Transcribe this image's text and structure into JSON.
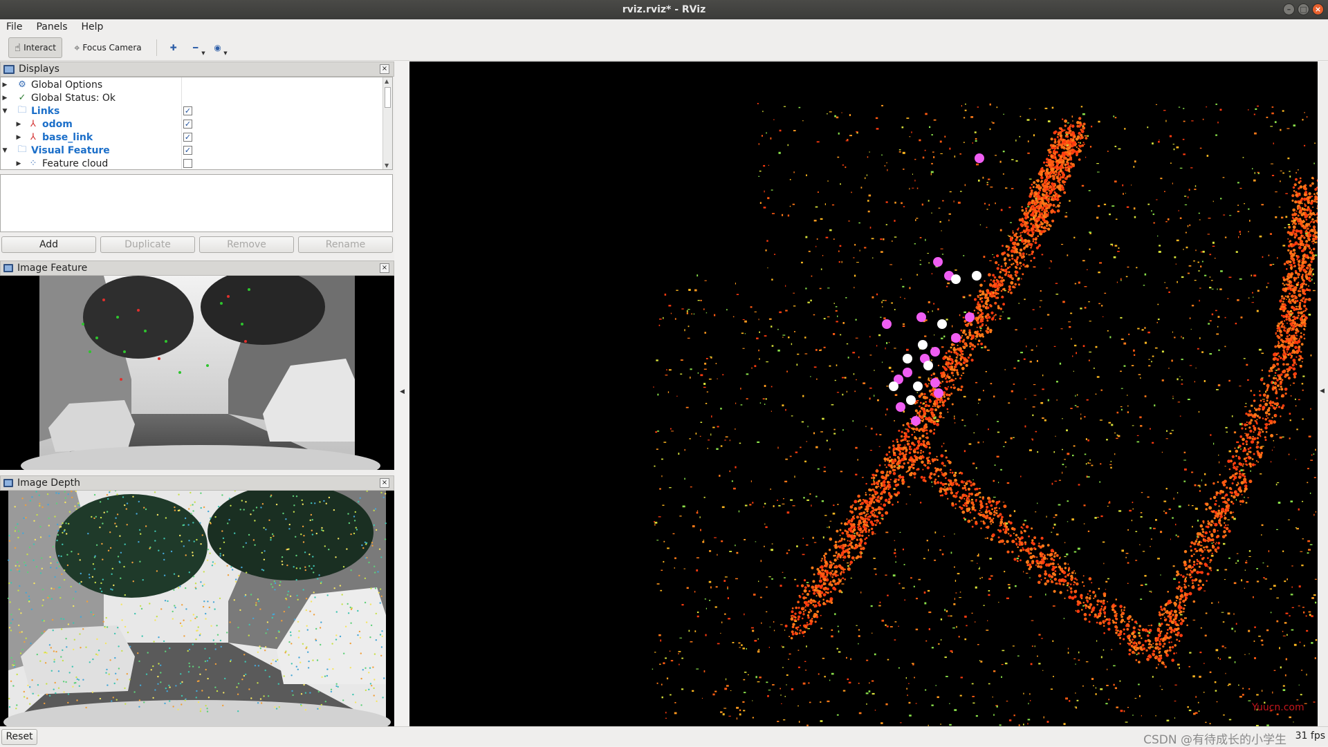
{
  "window": {
    "title": "rviz.rviz* - RViz"
  },
  "menu": [
    "File",
    "Panels",
    "Help"
  ],
  "toolbar": {
    "interact": "Interact",
    "focus_camera": "Focus Camera"
  },
  "displays": {
    "title": "Displays",
    "rows": [
      {
        "label": "Global Options",
        "icon": "gear-icon",
        "checked": null
      },
      {
        "label": "Global Status: Ok",
        "icon": "check-icon",
        "checked": null
      },
      {
        "label": "Links",
        "icon": "folder-icon",
        "checked": true
      },
      {
        "label": "odom",
        "icon": "axes-icon",
        "checked": true
      },
      {
        "label": "base_link",
        "icon": "axes-icon",
        "checked": true
      },
      {
        "label": "Visual Feature",
        "icon": "folder-icon",
        "checked": true
      },
      {
        "label": "Feature cloud",
        "icon": "pointcloud-icon",
        "checked": false
      }
    ],
    "buttons": {
      "add": "Add",
      "duplicate": "Duplicate",
      "remove": "Remove",
      "rename": "Rename"
    }
  },
  "image_feature": {
    "title": "Image Feature"
  },
  "image_depth": {
    "title": "Image Depth"
  },
  "status": {
    "reset": "Reset",
    "fps": "31 fps",
    "watermark": "CSDN @有待成长的小学生",
    "watermark_red": "Yuucn.com"
  },
  "colors": {
    "selected_blue": "#1c6fc9",
    "close_orange": "#e9612e"
  }
}
